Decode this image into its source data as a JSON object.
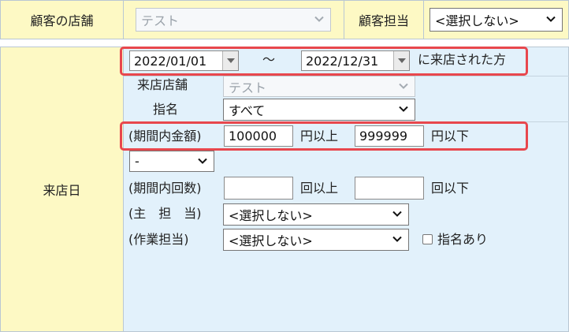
{
  "row1": {
    "store_label": "顧客の店舗",
    "store_select": "テスト",
    "staff_label": "顧客担当",
    "staff_select": "<選択しない>"
  },
  "visit": {
    "label": "来店日",
    "date_from": "2022/01/01",
    "tilde": "～",
    "date_to": "2022/12/31",
    "suffix": "に来店された方",
    "store_label": "来店店舗",
    "store_select": "テスト",
    "nomination_label": "指名",
    "nomination_select": "すべて",
    "amount_label": "(期間内金額)",
    "amount_min": "100000",
    "amount_min_unit": "円以上",
    "amount_max": "999999",
    "amount_max_unit": "円以下",
    "operator_select": "-",
    "count_label": "(期間内回数)",
    "count_min": "",
    "count_min_unit": "回以上",
    "count_max": "",
    "count_max_unit": "回以下",
    "main_staff_label": "(主　担　当)",
    "main_staff_select": "<選択しない>",
    "work_staff_label": "(作業担当)",
    "work_staff_select": "<選択しない>",
    "nominated_label": "指名あり",
    "nominated_checked": false
  }
}
